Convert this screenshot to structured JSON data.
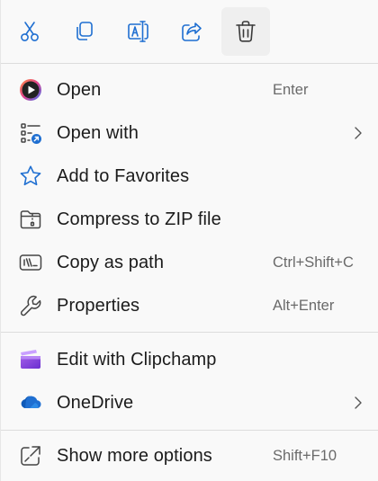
{
  "toolbar": {
    "buttons": [
      {
        "icon": "scissors-icon",
        "tooltip": "Cut"
      },
      {
        "icon": "copy-icon",
        "tooltip": "Copy"
      },
      {
        "icon": "rename-icon",
        "tooltip": "Rename"
      },
      {
        "icon": "share-icon",
        "tooltip": "Share"
      },
      {
        "icon": "trash-icon",
        "tooltip": "Delete"
      }
    ]
  },
  "items_group1": [
    {
      "label": "Open",
      "shortcut": "Enter",
      "icon": "media-player-icon"
    },
    {
      "label": "Open with",
      "shortcut": "",
      "icon": "open-with-icon",
      "submenu": true
    },
    {
      "label": "Add to Favorites",
      "shortcut": "",
      "icon": "star-icon"
    },
    {
      "label": "Compress to ZIP file",
      "shortcut": "",
      "icon": "zip-folder-icon"
    },
    {
      "label": "Copy as path",
      "shortcut": "Ctrl+Shift+C",
      "icon": "copy-path-icon"
    },
    {
      "label": "Properties",
      "shortcut": "Alt+Enter",
      "icon": "wrench-icon"
    }
  ],
  "items_group2": [
    {
      "label": "Edit with Clipchamp",
      "shortcut": "",
      "icon": "clipchamp-icon"
    },
    {
      "label": "OneDrive",
      "shortcut": "",
      "icon": "onedrive-icon",
      "submenu": true
    }
  ],
  "items_group3": [
    {
      "label": "Show more options",
      "shortcut": "Shift+F10",
      "icon": "show-more-icon"
    }
  ],
  "colors": {
    "accent": "#1f6fd1",
    "text": "#1b1b1b",
    "shortcut_text": "#6a6a6a",
    "background": "#f9f9f9"
  }
}
